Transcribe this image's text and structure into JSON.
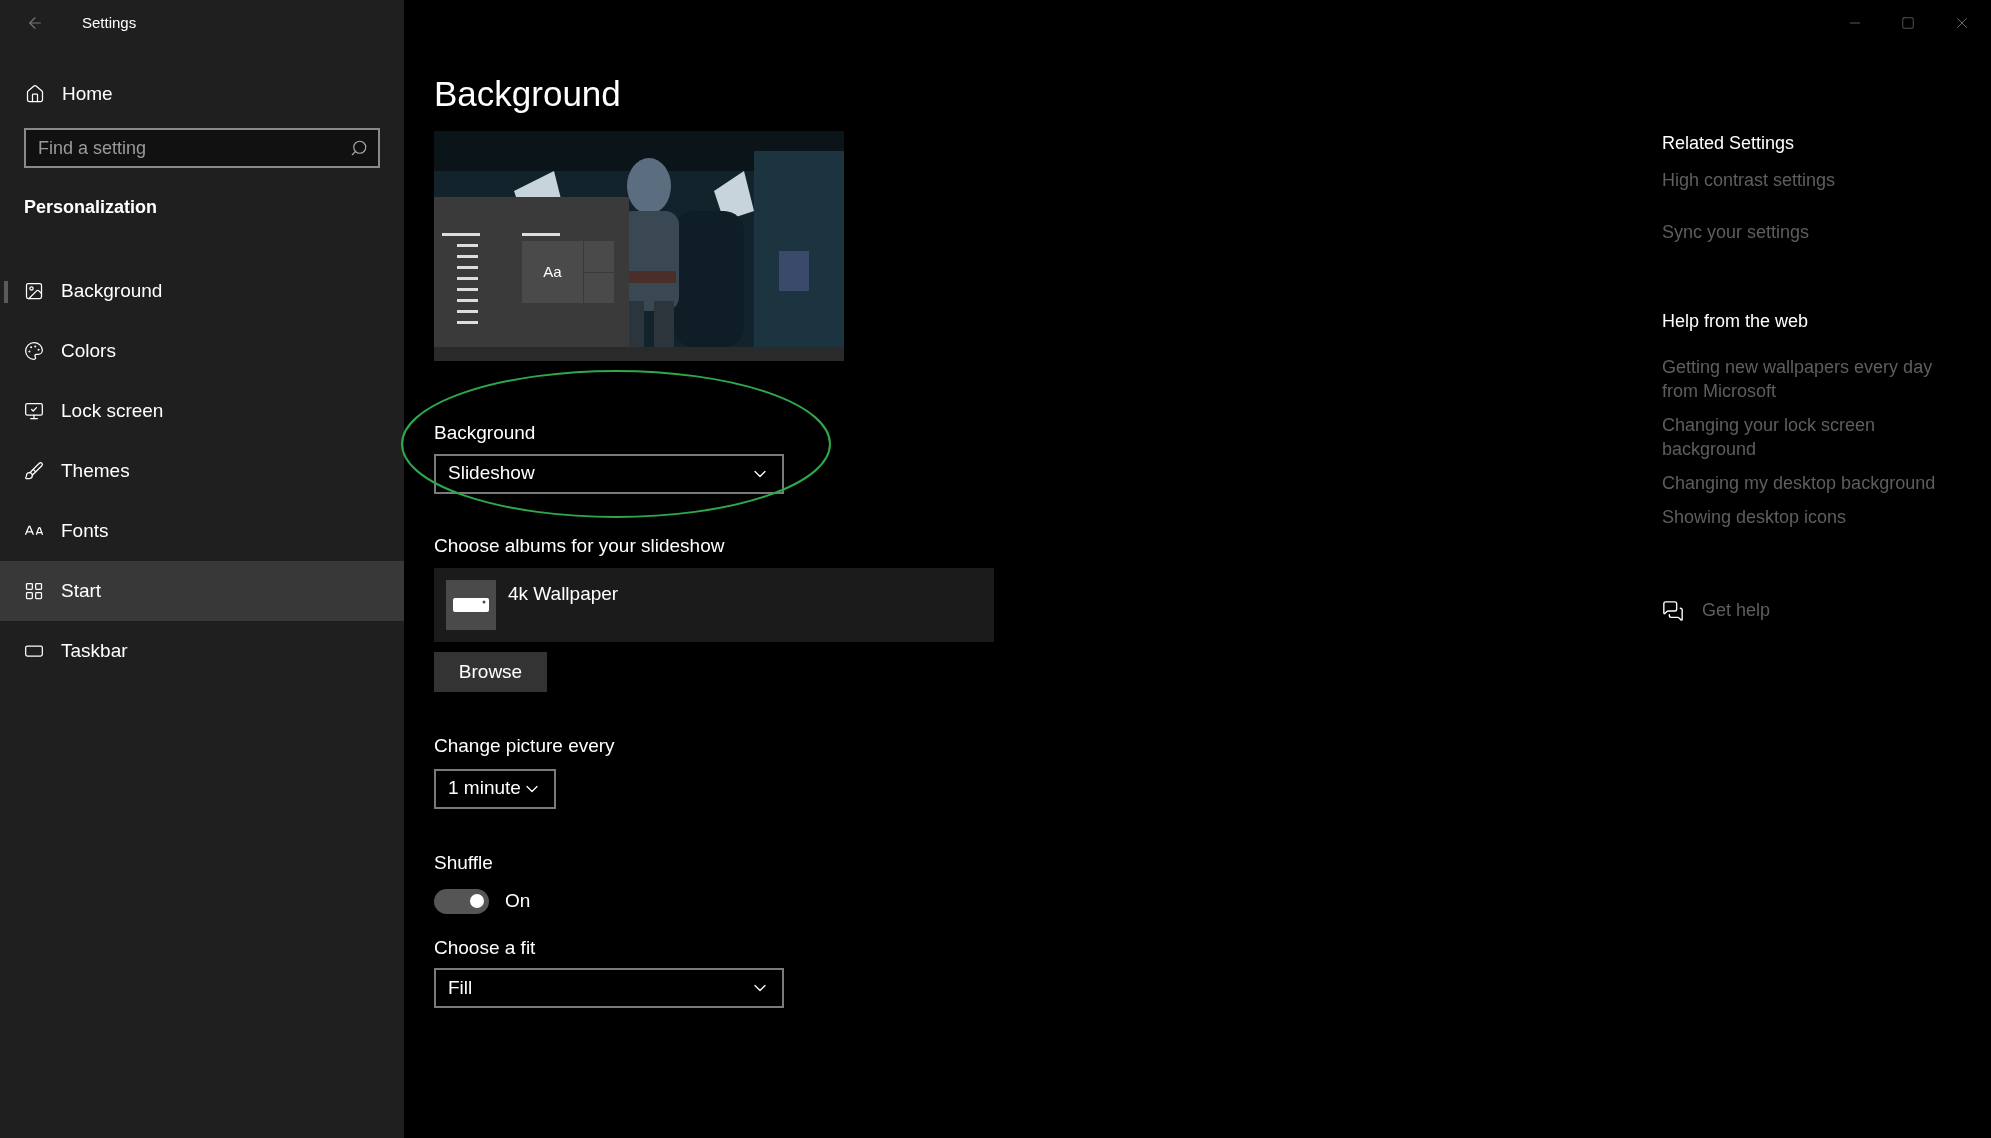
{
  "window": {
    "title": "Settings"
  },
  "sidebar": {
    "home": "Home",
    "search": {
      "placeholder": "Find a setting"
    },
    "section": "Personalization",
    "items": [
      {
        "label": "Background",
        "kind": "picture",
        "selected": true,
        "hovered": false
      },
      {
        "label": "Colors",
        "kind": "palette",
        "selected": false,
        "hovered": false
      },
      {
        "label": "Lock screen",
        "kind": "lock",
        "selected": false,
        "hovered": false
      },
      {
        "label": "Themes",
        "kind": "themes",
        "selected": false,
        "hovered": false
      },
      {
        "label": "Fonts",
        "kind": "fonts",
        "selected": false,
        "hovered": false
      },
      {
        "label": "Start",
        "kind": "start",
        "selected": false,
        "hovered": true
      },
      {
        "label": "Taskbar",
        "kind": "taskbar",
        "selected": false,
        "hovered": false
      }
    ]
  },
  "page": {
    "title": "Background",
    "preview": {
      "tile_text": "Aa"
    },
    "background": {
      "label": "Background",
      "value": "Slideshow",
      "highlighted": true
    },
    "albums": {
      "label": "Choose albums for your slideshow",
      "album": "4k Wallpaper",
      "browse": "Browse"
    },
    "interval": {
      "label": "Change picture every",
      "value": "1 minute"
    },
    "shuffle": {
      "label": "Shuffle",
      "on": true,
      "state_text": "On"
    },
    "fit": {
      "label": "Choose a fit",
      "value": "Fill"
    }
  },
  "related": {
    "title": "Related Settings",
    "links": [
      "High contrast settings",
      "Sync your settings"
    ]
  },
  "help": {
    "title": "Help from the web",
    "links": [
      "Getting new wallpapers every day from Microsoft",
      "Changing your lock screen background",
      "Changing my desktop background",
      "Showing desktop icons"
    ],
    "get_help": "Get help"
  }
}
